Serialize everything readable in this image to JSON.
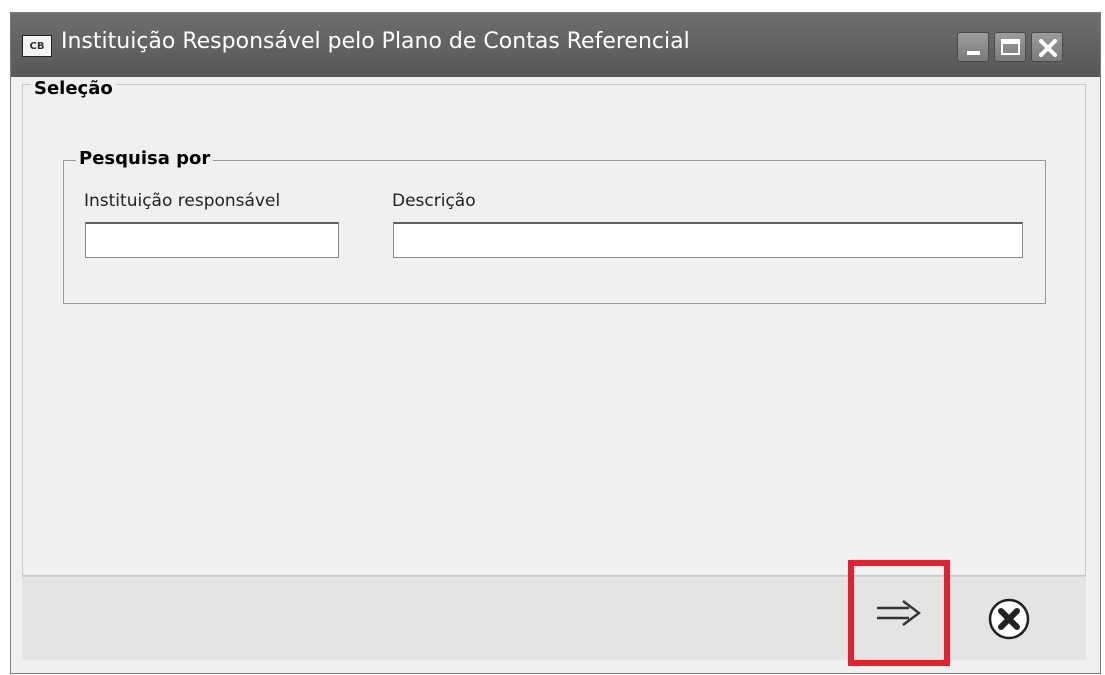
{
  "window": {
    "title": "Instituição Responsável pelo Plano de Contas Referencial",
    "app_icon_text": "CB",
    "controls": {
      "minimize_icon": "minimize-icon",
      "maximize_icon": "maximize-icon",
      "close_icon": "close-icon"
    }
  },
  "selection_group": {
    "legend": "Seleção",
    "search_group": {
      "legend": "Pesquisa por",
      "fields": [
        {
          "label": "Instituição responsável",
          "value": ""
        },
        {
          "label": "Descrição",
          "value": ""
        }
      ]
    }
  },
  "actions": {
    "next_icon": "arrow-right-icon",
    "cancel_icon": "cancel-x-icon",
    "highlight_color": "#e8202a"
  }
}
